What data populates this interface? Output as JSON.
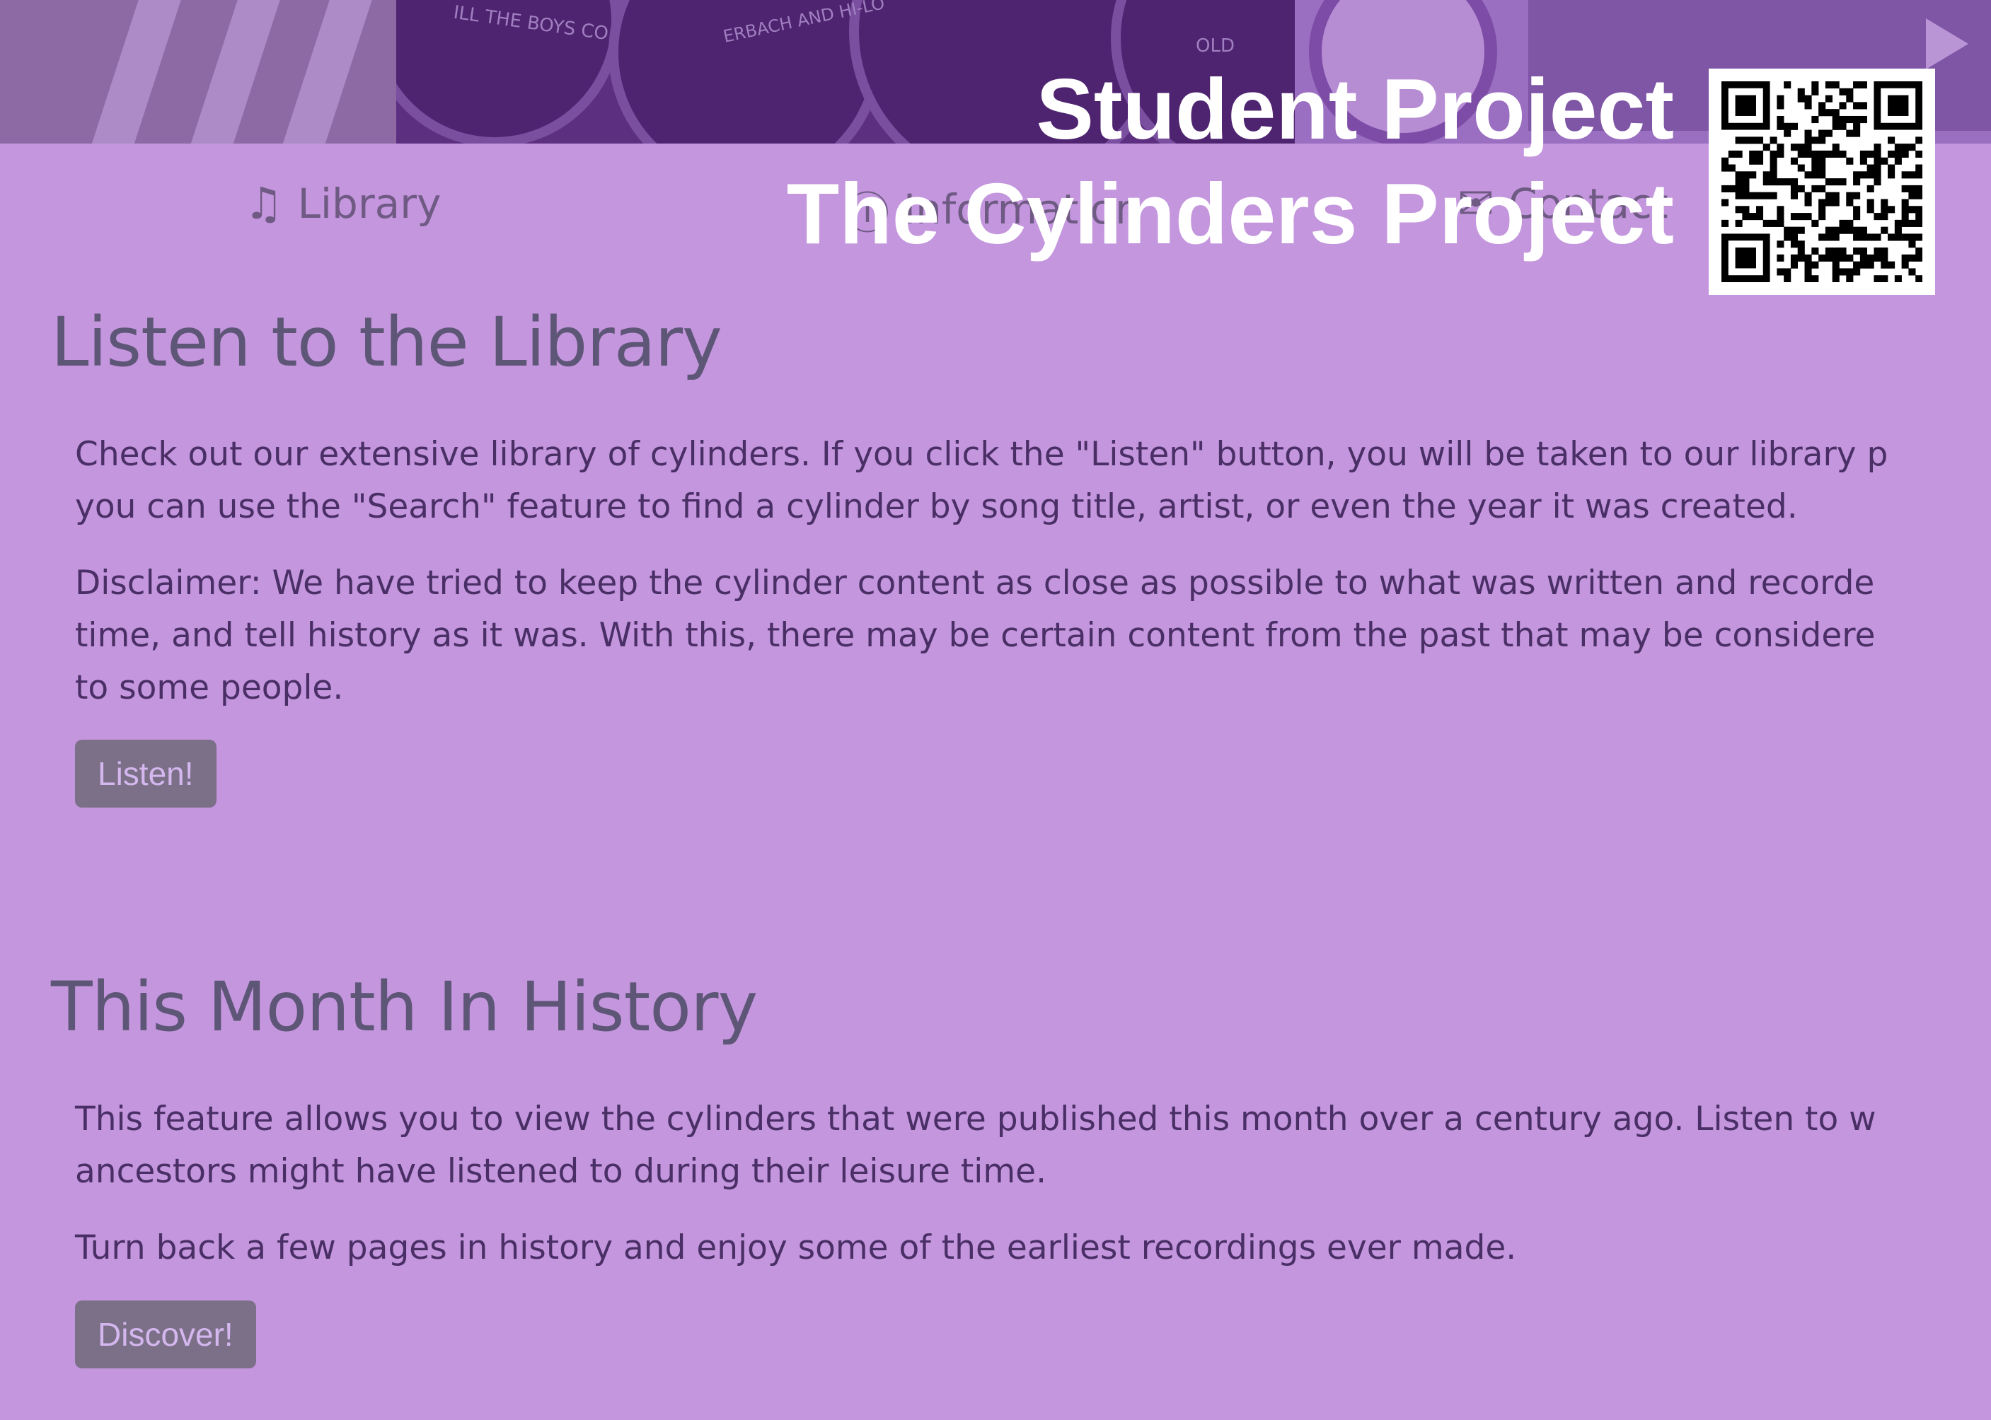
{
  "overlay": {
    "line1": "Student Project",
    "line2": "The Cylinders Project"
  },
  "banner": {
    "can_texts": [
      "ILL THE BOYS CO",
      "ERBACH AND HI-LO",
      "OLD"
    ]
  },
  "nav": {
    "items": [
      {
        "label": "Library",
        "icon": "music-note-icon"
      },
      {
        "label": "Information",
        "icon": "info-icon"
      },
      {
        "label": "Contact",
        "icon": "mail-icon"
      }
    ]
  },
  "library": {
    "heading": "Listen to the Library",
    "p1_line1": "Check out our extensive library of cylinders. If you click the \"Listen\" button, you will be taken to our library p",
    "p1_line2": "you can use the \"Search\" feature to find a cylinder by song title, artist, or even the year it was created.",
    "p2_line1": "Disclaimer: We have tried to keep the cylinder content as close as possible to what was written and recorde",
    "p2_line2": "time, and tell history as it was. With this, there may be certain content from the past that may be considere",
    "p2_line3": "to some people.",
    "button": "Listen!"
  },
  "history": {
    "heading": "This Month In History",
    "p1_line1": "This feature allows you to view the cylinders that were published this month over a century ago. Listen to w",
    "p1_line2": "ancestors might have listened to during their leisure time.",
    "p2_line1": "Turn back a few pages in history and enjoy some of the earliest recordings ever made.",
    "button": "Discover!"
  },
  "colors": {
    "background": "#c496de",
    "heading": "#5e5676",
    "text": "#4a2f66",
    "button": "#7c6f88"
  }
}
